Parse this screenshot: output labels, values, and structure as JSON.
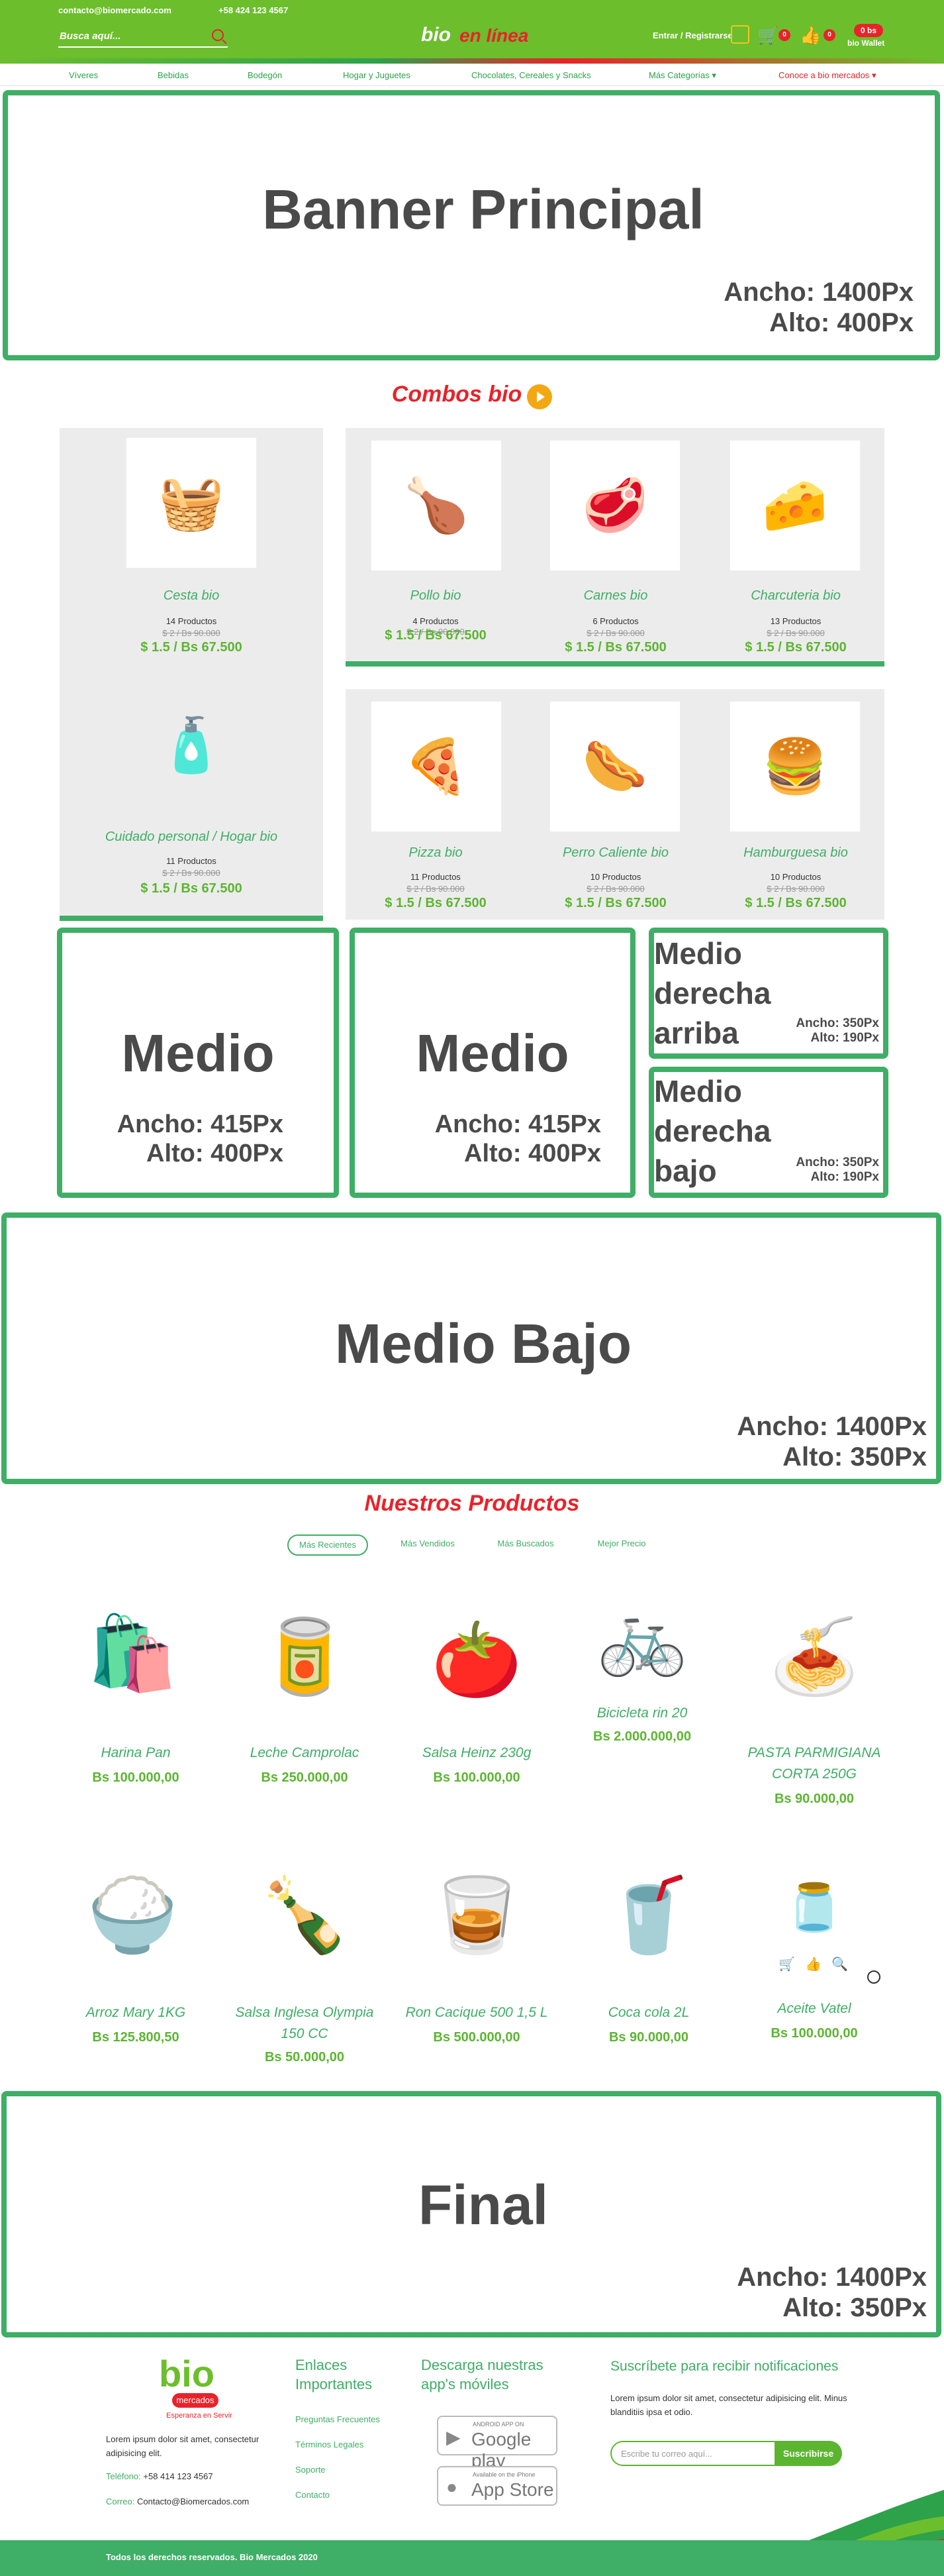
{
  "topbar": {
    "email": "contacto@biomercado.com",
    "phone": "+58 424 123 4567",
    "search_placeholder": "Busca aquí...",
    "logo_bio": "bio",
    "logo_enlinea": "en línea",
    "login_label": "Entrar / Registrarse",
    "cart_count": "0",
    "fav_count": "0",
    "wallet_amount": "0 bs",
    "wallet_label": "bio Wallet",
    "colors": {
      "primary_green": "#6cbe2d",
      "accent_red": "#e8232a",
      "icon_yellow": "#f5c518"
    }
  },
  "menu": {
    "items": [
      "Víveres",
      "Bebidas",
      "Bodegón",
      "Hogar y Juguetes",
      "Chocolates, Cereales y Snacks",
      "Más Categorías",
      "Conoce a bio mercados"
    ]
  },
  "banner_principal": {
    "title": "Banner Principal",
    "width_label": "Ancho: 1400Px",
    "height_label": "Alto: 400Px"
  },
  "combos": {
    "title": "Combos bio",
    "items": [
      {
        "name": "Cesta bio",
        "count": "14 Productos",
        "old_price": "$ 2 / Bs 90.000",
        "price": "$ 1.5 / Bs 67.500",
        "icon": "basket-icon"
      },
      {
        "name": "Cuidado personal / Hogar bio",
        "count": "11 Productos",
        "old_price": "$ 2 / Bs 90.000",
        "price": "$ 1.5 / Bs 67.500",
        "icon": "cleaning-basket-icon"
      },
      {
        "name": "Pollo bio",
        "count": "4 Productos",
        "old_price": "$ 2 / Bs 90.000",
        "price": "$ 1.5 / Bs 67.500",
        "icon": "chicken-icon"
      },
      {
        "name": "Carnes bio",
        "count": "6 Productos",
        "old_price": "$ 2 / Bs 90.000",
        "price": "$ 1.5 / Bs 67.500",
        "icon": "meat-icon"
      },
      {
        "name": "Charcuteria bio",
        "count": "13 Productos",
        "old_price": "$ 2 / Bs 90.000",
        "price": "$ 1.5 / Bs 67.500",
        "icon": "cheese-icon"
      },
      {
        "name": "Pizza bio",
        "count": "11 Productos",
        "old_price": "$ 2 / Bs 90.000",
        "price": "$ 1.5 / Bs 67.500",
        "icon": "pizza-icon"
      },
      {
        "name": "Perro Caliente bio",
        "count": "10 Productos",
        "old_price": "$ 2 / Bs 90.000",
        "price": "$ 1.5 / Bs 67.500",
        "icon": "hotdog-icon"
      },
      {
        "name": "Hamburguesa bio",
        "count": "10 Productos",
        "old_price": "$ 2 / Bs 90.000",
        "price": "$ 1.5 / Bs 67.500",
        "icon": "burger-icon"
      }
    ]
  },
  "medio": {
    "left": {
      "title": "Medio",
      "width_label": "Ancho: 415Px",
      "height_label": "Alto: 400Px"
    },
    "center": {
      "title": "Medio",
      "width_label": "Ancho: 415Px",
      "height_label": "Alto: 400Px"
    },
    "right_top": {
      "title_l1": "Medio",
      "title_l2": "derecha",
      "title_l3": "arriba",
      "width_label": "Ancho: 350Px",
      "height_label": "Alto: 190Px"
    },
    "right_bottom": {
      "title_l1": "Medio",
      "title_l2": "derecha",
      "title_l3": "bajo",
      "width_label": "Ancho: 350Px",
      "height_label": "Alto: 190Px"
    }
  },
  "medio_bajo": {
    "title": "Medio Bajo",
    "width_label": "Ancho: 1400Px",
    "height_label": "Alto: 350Px"
  },
  "productos": {
    "title": "Nuestros Productos",
    "tabs": [
      "Más Recientes",
      "Más Vendidos",
      "Más Buscados",
      "Mejor Precio"
    ],
    "items": [
      {
        "name": "Harina Pan",
        "price": "Bs 100.000,00",
        "icon": "flour-bag-icon"
      },
      {
        "name": "Leche Camprolac",
        "price": "Bs 250.000,00",
        "icon": "milk-can-icon"
      },
      {
        "name": "Salsa Heinz 230g",
        "price": "Bs 100.000,00",
        "icon": "ketchup-icon"
      },
      {
        "name": "Bicicleta rin 20",
        "price": "Bs 2.000.000,00",
        "icon": "bicycle-icon"
      },
      {
        "name_l1": "PASTA PARMIGIANA",
        "name_l2": "CORTA 250G",
        "price": "Bs 90.000,00",
        "icon": "pasta-bag-icon"
      },
      {
        "name": "Arroz Mary 1KG",
        "price": "Bs 125.800,50",
        "icon": "rice-bag-icon"
      },
      {
        "name_l1": "Salsa Inglesa Olympia",
        "name_l2": "150 CC",
        "price": "Bs 50.000,00",
        "icon": "sauce-bottle-icon"
      },
      {
        "name": "Ron Cacique 500 1,5 L",
        "price": "Bs 500.000,00",
        "icon": "rum-bottle-icon"
      },
      {
        "name": "Coca cola 2L",
        "price": "Bs 90.000,00",
        "icon": "soda-bottle-icon"
      },
      {
        "name": "Aceite Vatel",
        "price": "Bs 100.000,00",
        "icon": "oil-bottle-icon"
      }
    ]
  },
  "final": {
    "title": "Final",
    "width_label": "Ancho: 1400Px",
    "height_label": "Alto: 350Px"
  },
  "footer": {
    "logo_text": "bio",
    "logo_sub": "mercados",
    "logo_tagline": "Esperanza en Servir",
    "about": "Lorem ipsum dolor sit amet, consectetur adipisicing elit.",
    "phone_label": "Teléfono:",
    "phone": "+58 414 123 4567",
    "email_label": "Correo:",
    "email": "Contacto@Biomercados.com",
    "links_title_l1": "Enlaces",
    "links_title_l2": "Importantes",
    "links": [
      "Preguntas Frecuentes",
      "Términos Legales",
      "Soporte",
      "Contacto"
    ],
    "apps_title_l1": "Descarga nuestras",
    "apps_title_l2": "app's móviles",
    "google_small": "ANDROID APP ON",
    "google_big": "Google play",
    "apple_small": "Available on the iPhone",
    "apple_big": "App Store",
    "newsletter_title": "Suscríbete para recibir notificaciones",
    "newsletter_text": "Lorem ipsum dolor sit amet, consectetur adipisicing elit. Minus blanditiis ipsa et odio.",
    "newsletter_placeholder": "Escribe tu correo aquí...",
    "subscribe_label": "Suscribirse",
    "copyright": "Todos los derechos reservados. Bio Mercados 2020"
  }
}
